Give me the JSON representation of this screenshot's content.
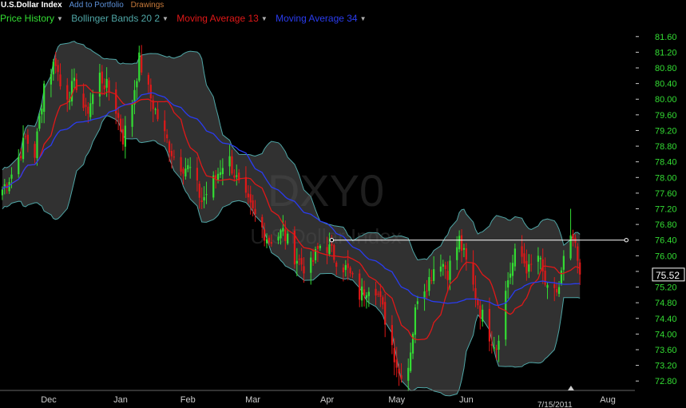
{
  "toolbar": {
    "title": "U.S.Dollar Index",
    "add_portfolio": "Add to Portfolio",
    "drawings": "Drawings",
    "add_color": "#5b8fd6",
    "drawings_color": "#c87a3a"
  },
  "legend": [
    {
      "label": "Price History",
      "color": "#33dd33",
      "arrow_icon": "dropdown-arrow-icon"
    },
    {
      "label": "Bollinger Bands 20 2",
      "color": "#4fa6a6",
      "arrow_icon": "dropdown-arrow-icon"
    },
    {
      "label": "Moving Average 13",
      "color": "#e01818",
      "arrow_icon": "dropdown-arrow-icon"
    },
    {
      "label": "Moving Average 34",
      "color": "#2a3cf0",
      "arrow_icon": "dropdown-arrow-icon"
    }
  ],
  "watermark": {
    "symbol": "DXY0",
    "name": "U.S.Dollar Index"
  },
  "chart_data": {
    "type": "candlestick",
    "x_labels": [
      "Dec",
      "Jan",
      "Feb",
      "Mar",
      "Apr",
      "May",
      "Jun",
      "Aug"
    ],
    "x_label_days": [
      6,
      37,
      66,
      94,
      126,
      156,
      186,
      247
    ],
    "date_label": "7/15/2011",
    "date_label_day": 227,
    "y_ticks": [
      72.8,
      73.2,
      73.6,
      74.0,
      74.4,
      74.8,
      75.2,
      75.6,
      76.0,
      76.4,
      76.8,
      77.2,
      77.6,
      78.0,
      78.4,
      78.8,
      79.2,
      79.6,
      80.0,
      80.4,
      80.8,
      81.2,
      81.6
    ],
    "ylim": [
      72.6,
      81.8
    ],
    "xlim_days": [
      -15,
      258
    ],
    "last_price": 75.52,
    "trend_line": {
      "x1_day": 128,
      "x2_day": 255,
      "value": 76.4
    },
    "up_color": "#33dd33",
    "down_color": "#e01818",
    "band_fill": "#3a3a3a",
    "band_stroke": "#4fa6a6",
    "ma13_color": "#e01818",
    "ma34_color": "#2a3cf0",
    "grid": false,
    "spike": {
      "day": 231,
      "high": 77.2
    },
    "close_keyframes": [
      [
        -15,
        77.6
      ],
      [
        -9,
        78.2
      ],
      [
        -4,
        79.0
      ],
      [
        0,
        78.6
      ],
      [
        4,
        80.4
      ],
      [
        9,
        81.0
      ],
      [
        12,
        80.0
      ],
      [
        18,
        80.4
      ],
      [
        22,
        79.6
      ],
      [
        28,
        80.6
      ],
      [
        34,
        80.0
      ],
      [
        38,
        79.0
      ],
      [
        41,
        79.6
      ],
      [
        45,
        81.0
      ],
      [
        49,
        80.2
      ],
      [
        55,
        79.2
      ],
      [
        61,
        78.4
      ],
      [
        67,
        78.2
      ],
      [
        72,
        77.4
      ],
      [
        78,
        78.0
      ],
      [
        83,
        78.6
      ],
      [
        89,
        77.6
      ],
      [
        95,
        77.0
      ],
      [
        101,
        76.4
      ],
      [
        107,
        76.6
      ],
      [
        112,
        76.0
      ],
      [
        118,
        75.6
      ],
      [
        124,
        76.4
      ],
      [
        129,
        76.0
      ],
      [
        135,
        75.6
      ],
      [
        140,
        75.0
      ],
      [
        146,
        75.4
      ],
      [
        152,
        74.2
      ],
      [
        157,
        73.0
      ],
      [
        161,
        73.2
      ],
      [
        165,
        75.0
      ],
      [
        170,
        75.4
      ],
      [
        174,
        76.0
      ],
      [
        178,
        75.6
      ],
      [
        183,
        76.4
      ],
      [
        188,
        75.4
      ],
      [
        192,
        74.6
      ],
      [
        196,
        74.0
      ],
      [
        199,
        73.7
      ],
      [
        204,
        75.4
      ],
      [
        208,
        76.2
      ],
      [
        213,
        75.6
      ],
      [
        217,
        76.0
      ],
      [
        222,
        74.8
      ],
      [
        226,
        75.2
      ],
      [
        229,
        76.2
      ],
      [
        232,
        76.4
      ],
      [
        235,
        75.52
      ]
    ]
  }
}
